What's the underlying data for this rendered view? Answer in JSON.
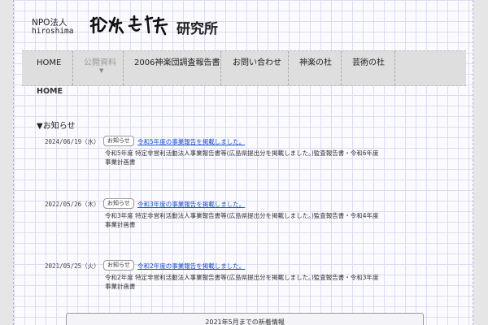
{
  "logo": {
    "npo": "NPO法人",
    "hiroshima": "hiroshima",
    "brush_text": "神楽芸術",
    "lab": "研究所"
  },
  "nav": {
    "items": [
      {
        "label": "HOME",
        "active": false
      },
      {
        "label": "公開資料",
        "active": true
      },
      {
        "label": "2006神楽団調査報告書",
        "active": false
      },
      {
        "label": "お問い合わせ",
        "active": false
      },
      {
        "label": "神楽の杜",
        "active": false
      },
      {
        "label": "芸術の杜",
        "active": false
      }
    ],
    "caret": "▼"
  },
  "breadcrumb": "HOME",
  "news": {
    "heading": "▼お知らせ",
    "tag_label": "お知らせ",
    "entries": [
      {
        "date": "2024/06/19（水）",
        "title": "令和5年度の事業報告を掲載しました。",
        "description": "令和5年度 特定非営利活動法人事業報告書等(広島県提出分を掲載しました。)監査報告書・令和6年度事業計画書"
      },
      {
        "date": "2022/05/26（木）",
        "title": "令和3年度の事業報告を掲載しました。",
        "description": "令和3年度 特定非営利活動法人事業報告書等(広島県提出分を掲載しました。)監査報告書・令和4年度事業計画書"
      },
      {
        "date": "2021/05/25（火）",
        "title": "令和2年度の事業報告を掲載しました。",
        "description": "令和2年度 特定非営利活動法人事業報告書等(広島県提出分を掲載しました。)監査報告書・令和3年度事業計画書"
      }
    ]
  },
  "bottom_box": "2021年5月までの新着情報",
  "colors": {
    "link": "#1a4fd6",
    "nav_bg": "#dedede",
    "grid": "#dcdcf2"
  }
}
